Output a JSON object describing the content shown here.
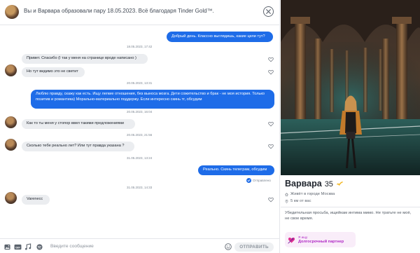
{
  "header": {
    "title": "Вы и Варвара образовали пару 18.05.2023. Всё благодаря Tinder Gold™."
  },
  "messages": {
    "m1": {
      "text": "Добрый день. Классно выглядишь, какие цели тут?"
    },
    "ts1": "18.05.2023, 17:42",
    "m2": {
      "text": "Привет. Спасибо (I так у меня на странице вроде написано )"
    },
    "m3": {
      "text": "Но тут видимо это не светит"
    },
    "ts2": "20.05.2023, 13:31",
    "m4": {
      "text": "Люблю правду, скажу как есть. Ищу легкие отношения, без выноса мозга. Дети сожительство и брак - не моя история. Только позитив и романтика) Морально-материально поддержу. Если интересно скинь тг, обсудим"
    },
    "ts3": "20.05.2023, 16:04",
    "m5": {
      "text": "Как то ты меня у стопор ввел такими предложениями"
    },
    "ts4": "20.05.2023, 21:56",
    "m6": {
      "text": "Сколько тебе реально лет? Или тут правда указана ?"
    },
    "ts5": "31.05.2023, 13:24",
    "m7": {
      "text": "Реально. Скинь телеграм, обсудим"
    },
    "status_sent": "Отправлено",
    "ts6": "31.05.2023, 14:33",
    "m8": {
      "text": "Varenecc"
    }
  },
  "composer": {
    "placeholder": "Введите сообщение",
    "send_label": "ОТПРАВИТЬ",
    "gif_label": "GIF"
  },
  "profile": {
    "name": "Варвара",
    "age": "35",
    "city": "Живёт в городе Москва",
    "distance": "5 км от вас",
    "bio": "Убедительная просьба, ищейкам интима мимо. Не тратьте не моё, не свое время.",
    "goal_label": "Я ищу",
    "goal_value": "Долгосрочный партнер"
  },
  "colors": {
    "accent_blue": "#1e6ce8",
    "incoming_bubble": "#ebedf0",
    "goal_purple": "#b02ac5"
  },
  "icons": {
    "close": "close-icon",
    "like": "heart-icon",
    "sent": "check-icon",
    "city": "home-icon",
    "distance": "location-pin-icon",
    "goal": "heart-arrow-icon",
    "composer": [
      "image-icon",
      "gif-icon",
      "music-icon",
      "spotify-icon",
      "emoji-icon"
    ]
  }
}
